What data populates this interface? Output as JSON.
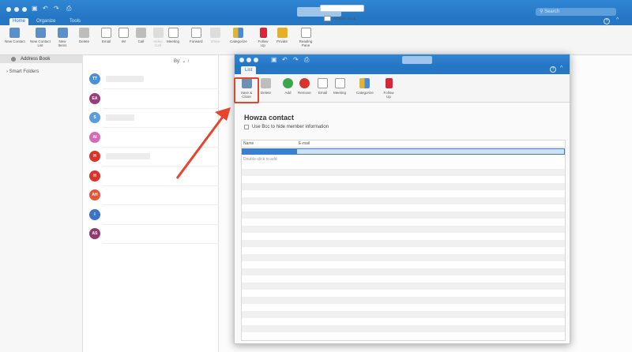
{
  "window": {
    "search_placeholder": "Search",
    "tabs": [
      {
        "label": "Home",
        "selected": true
      },
      {
        "label": "Organize",
        "selected": false
      },
      {
        "label": "Tools",
        "selected": false
      }
    ],
    "help": "?",
    "collapse": "^"
  },
  "ribbon": {
    "buttons": [
      "New Contact",
      "New Contact List",
      "New Items",
      "Delete",
      "Email",
      "IM",
      "Call",
      "Video Call",
      "Meeting",
      "Forward",
      "Share",
      "Categorize",
      "Follow Up",
      "Private",
      "Reading Pane"
    ],
    "address_book": "Address Book"
  },
  "sidebar": {
    "header": "Address Book",
    "items": [
      "Smart Folders"
    ]
  },
  "list": {
    "sort_label": "By:",
    "avatars": [
      {
        "initials": "TT",
        "color": "#4a90d9"
      },
      {
        "initials": "EA",
        "color": "#9b3b7a"
      },
      {
        "initials": "S",
        "color": "#5b9bd8"
      },
      {
        "initials": "AI",
        "color": "#d46bb8"
      },
      {
        "initials": "H",
        "color": "#d9342b"
      },
      {
        "initials": "H",
        "color": "#d9342b"
      },
      {
        "initials": "AH",
        "color": "#e2573a"
      },
      {
        "initials": "I",
        "color": "#3b74c4"
      },
      {
        "initials": "AS",
        "color": "#8e3a6e"
      }
    ]
  },
  "dialog": {
    "tab": "List",
    "help": "?",
    "collapse": "^",
    "ribbon": [
      "Save & Close",
      "Delete",
      "Add",
      "Remove",
      "Email",
      "Meeting",
      "Categorize",
      "Follow Up"
    ],
    "group_name": "Howza contact",
    "bcc_label": "Use Bcc to hide member information",
    "columns": [
      "Name",
      "E-mail"
    ],
    "add_hint": "Double-click to add"
  },
  "colors": {
    "accent": "#2577c4",
    "highlight": "#e8442b"
  }
}
